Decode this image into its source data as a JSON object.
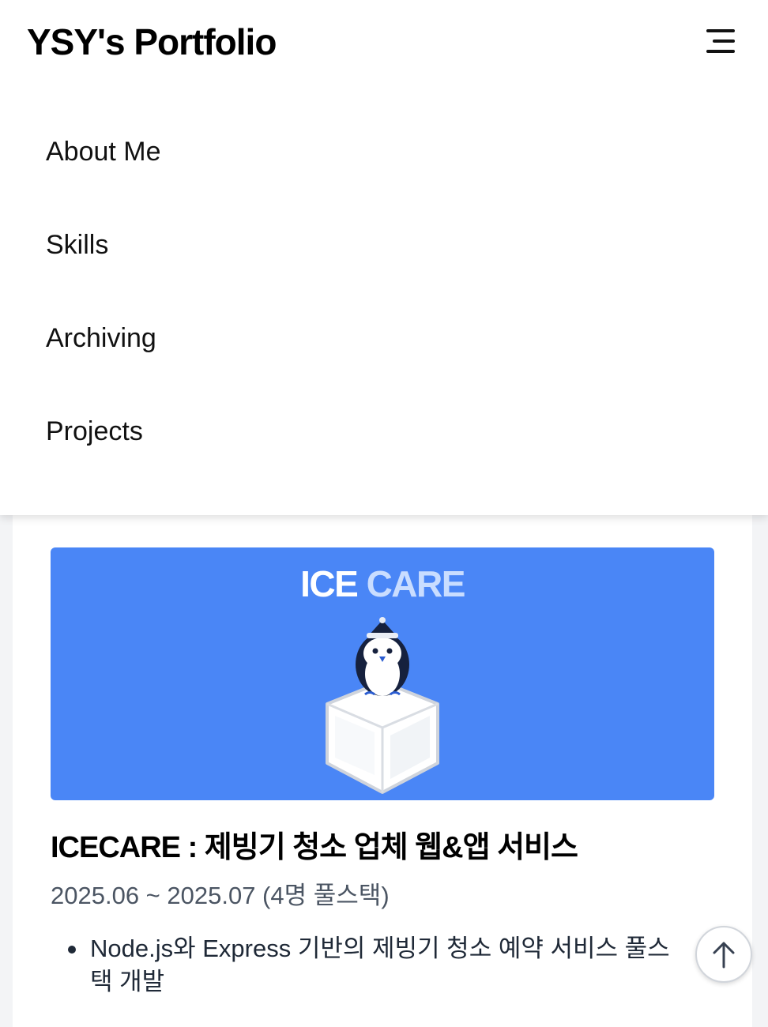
{
  "header": {
    "brand": "YSY's Portfolio",
    "menu_icon": "hamburger-menu-icon"
  },
  "nav": {
    "items": [
      {
        "label": "About Me"
      },
      {
        "label": "Skills"
      },
      {
        "label": "Archiving"
      },
      {
        "label": "Projects"
      }
    ]
  },
  "project": {
    "thumbnail": {
      "title_part1": "ICE",
      "title_part2": "CARE",
      "illustration": "penguin-on-ice-cube"
    },
    "title": "ICECARE : 제빙기 청소 업체 웹&앱 서비스",
    "period": "2025.06 ~ 2025.07 (4명 풀스택)",
    "bullets": [
      "Node.js와 Express 기반의 제빙기 청소 예약 서비스 풀스택 개발"
    ]
  },
  "scroll_top": {
    "icon": "arrow-up-icon"
  },
  "colors": {
    "accent": "#4a86f6",
    "background": "#f3f4f6",
    "surface": "#ffffff"
  }
}
